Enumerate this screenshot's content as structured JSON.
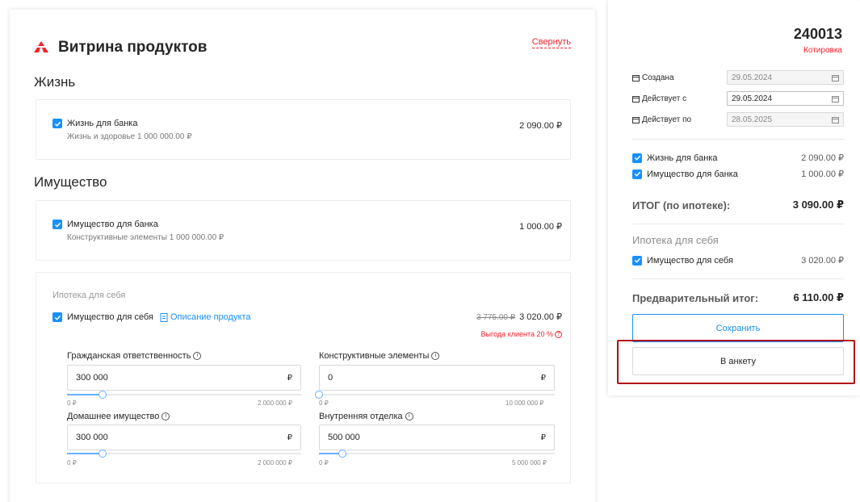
{
  "showcase": {
    "title": "Витрина продуктов",
    "collapse_label": "Свернуть",
    "life_section": {
      "title": "Жизнь",
      "product": {
        "name": "Жизнь для банка",
        "subtitle": "Жизнь и здоровье  1 000 000.00 ₽",
        "price": "2 090.00 ₽"
      }
    },
    "property_section": {
      "title": "Имущество",
      "product": {
        "name": "Имущество для банка",
        "subtitle": "Конструктивные элементы  1 000 000.00 ₽",
        "price": "1 000.00 ₽"
      }
    },
    "mortgage_self": {
      "label": "Ипотека для себя",
      "product_name": "Имущество для себя",
      "description_link": "Описание продукта",
      "old_price": "3 775.00 ₽",
      "price": "3 020.00 ₽",
      "benefit": "Выгода клиента 20 %",
      "benefit_icon": "?",
      "info_icon": "i",
      "fields": [
        {
          "label": "Гражданская ответственность",
          "value": "300 000",
          "currency": "₽",
          "min": "0 ₽",
          "max": "2 000 000 ₽",
          "level": 0.15
        },
        {
          "label": "Конструктивные элементы",
          "value": "0",
          "currency": "₽",
          "min": "0 ₽",
          "max": "10 000 000 ₽",
          "level": 0.0
        },
        {
          "label": "Домашнее имущество",
          "value": "300 000",
          "currency": "₽",
          "min": "0 ₽",
          "max": "2 000 000 ₽",
          "level": 0.15
        },
        {
          "label": "Внутренняя отделка",
          "value": "500 000",
          "currency": "₽",
          "min": "0 ₽",
          "max": "5 000 000 ₽",
          "level": 0.1
        }
      ]
    }
  },
  "quote": {
    "number": "240013",
    "status": "Котировка",
    "dates": [
      {
        "label": "Создана",
        "value": "29.05.2024",
        "state": "disabled"
      },
      {
        "label": "Действует с",
        "value": "29.05.2024",
        "state": "active"
      },
      {
        "label": "Действует по",
        "value": "28.05.2025",
        "state": "disabled"
      }
    ],
    "items": [
      {
        "name": "Жизнь для банка",
        "value": "2 090.00 ₽"
      },
      {
        "name": "Имущество для банка",
        "value": "1 000.00 ₽"
      }
    ],
    "mortgage_total_label": "ИТОГ (по ипотеке):",
    "mortgage_total_value": "3 090.00 ₽",
    "self_heading": "Ипотека для себя",
    "self_item": {
      "name": "Имущество для себя",
      "value": "3 020.00 ₽"
    },
    "prelim_label": "Предварительный итог:",
    "prelim_value": "6 110.00 ₽",
    "save_label": "Сохранить",
    "form_label": "В анкету"
  },
  "colors": {
    "accent": "#1890ff",
    "brand_red": "#f5222d",
    "highlight": "#b30f0f"
  }
}
